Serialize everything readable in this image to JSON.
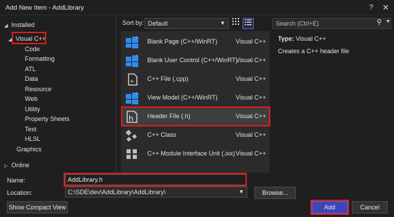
{
  "window": {
    "title": "Add New Item - AddLibrary",
    "help_glyph": "?",
    "close_glyph": "✕"
  },
  "left_tree": {
    "installed": "Installed",
    "visual_cpp": "Visual C++",
    "children": [
      "Code",
      "Formatting",
      "ATL",
      "Data",
      "Resource",
      "Web",
      "Utility",
      "Property Sheets",
      "Test",
      "HLSL"
    ],
    "graphics": "Graphics",
    "online": "Online"
  },
  "sort": {
    "label": "Sort by:",
    "value": "Default"
  },
  "search": {
    "placeholder": "Search (Ctrl+E)"
  },
  "templates": [
    {
      "name": "Blank Page (C++/WinRT)",
      "lang": "Visual C++",
      "icon": "blank-page-icon"
    },
    {
      "name": "Blank User Control (C++/WinRT)",
      "lang": "Visual C++",
      "icon": "user-control-icon"
    },
    {
      "name": "C++ File (.cpp)",
      "lang": "Visual C++",
      "icon": "cpp-file-icon"
    },
    {
      "name": "View Model (C++/WinRT)",
      "lang": "Visual C++",
      "icon": "view-model-icon"
    },
    {
      "name": "Header File (.h)",
      "lang": "Visual C++",
      "icon": "header-file-icon"
    },
    {
      "name": "C++ Class",
      "lang": "Visual C++",
      "icon": "cpp-class-icon"
    },
    {
      "name": "C++ Module Interface Unit (.ixx)",
      "lang": "Visual C++",
      "icon": "module-interface-icon"
    }
  ],
  "details": {
    "type_label": "Type:",
    "type_value": "Visual C++",
    "description": "Creates a C++ header file"
  },
  "form": {
    "name_label": "Name:",
    "name_value": "AddLibrary.h",
    "location_label": "Location:",
    "location_value": "C:\\SDE\\dev\\AddLibrary\\AddLibrary\\",
    "browse_label": "Browse...",
    "compact_label": "Show Compact View",
    "add_label": "Add",
    "cancel_label": "Cancel"
  },
  "colors": {
    "highlight": "#e01b1b",
    "accent": "#3d46b8",
    "icon_blue": "#2d8cf0"
  }
}
